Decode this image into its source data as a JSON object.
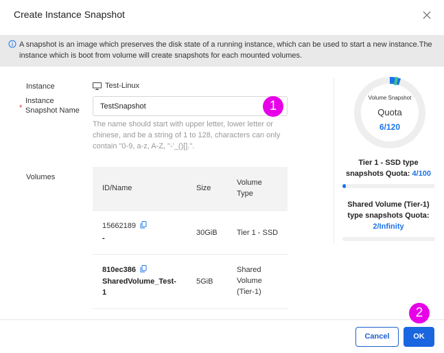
{
  "dialog": {
    "title": "Create Instance Snapshot"
  },
  "info": {
    "text": "A snapshot is an image which preserves the disk state of a running instance, which can be used to start a new instance.The instance which is boot from volume will create snapshots for each mounted volumes."
  },
  "form": {
    "instance_label": "Instance",
    "instance_value": "Test-Linux",
    "snapshot_label_line1": "Instance",
    "snapshot_label_line2": "Snapshot Name",
    "snapshot_value": "TestSnapshot",
    "hint": "The name should start with upper letter, lower letter or chinese, and be a string of 1 to 128, characters can only contain \"0-9, a-z, A-Z, \"-'_()[].\".",
    "volumes_label": "Volumes"
  },
  "volumes": {
    "headers": {
      "id_name": "ID/Name",
      "size": "Size",
      "type_line1": "Volume",
      "type_line2": "Type"
    },
    "rows": [
      {
        "id": "15662189",
        "name": "-",
        "size": "30GiB",
        "type1": "Tier 1 - SSD",
        "type2": "",
        "type3": ""
      },
      {
        "id": "810ec386",
        "name1": "SharedVolume_Test-",
        "name2": "1",
        "size": "5GiB",
        "type1": "Shared",
        "type2": "Volume",
        "type3": "(Tier-1)"
      }
    ]
  },
  "quota": {
    "ring_title": "Volume Snapshot",
    "ring_label": "Quota",
    "ring_value": "6/120",
    "ring_fraction": 0.05,
    "tier1_line1": "Tier 1 - SSD type",
    "tier1_line2": "snapshots Quota: ",
    "tier1_value": "4/100",
    "tier1_fraction": 0.04,
    "shared_line1": "Shared Volume (Tier-1)",
    "shared_line2": "type snapshots Quota:",
    "shared_value": "2/Infinity",
    "shared_fraction": 0
  },
  "annotations": {
    "badge1": "1",
    "badge2": "2"
  },
  "buttons": {
    "cancel": "Cancel",
    "ok": "OK"
  },
  "colors": {
    "accent": "#1a73e8",
    "badge": "#e800e8",
    "ring_green": "#3cc48f"
  },
  "icons": {
    "close": "close-icon",
    "info": "info-icon",
    "instance": "monitor-icon",
    "copy": "copy-icon"
  }
}
